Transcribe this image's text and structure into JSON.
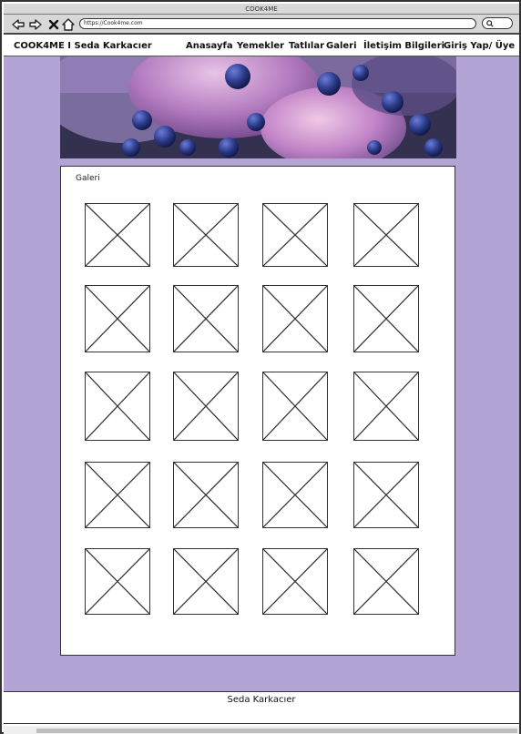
{
  "window": {
    "title": "COOK4ME"
  },
  "browser": {
    "url": "https://Cook4me.com",
    "buttons": [
      "back-icon",
      "forward-icon",
      "close-icon",
      "home-icon"
    ],
    "search_icon": "search-icon"
  },
  "nav": {
    "brand": "COOK4ME I Seda Karkacıer",
    "items": [
      {
        "label": "Anasayfa"
      },
      {
        "label": "Yemekler"
      },
      {
        "label": "Tatlılar"
      },
      {
        "label": "Galeri"
      },
      {
        "label": "İletişim Bilgileri"
      },
      {
        "label": "Giriş Yap/ Üye"
      }
    ]
  },
  "hero": {
    "image": "blueberry-ice-cream-image"
  },
  "gallery": {
    "title": "Galeri",
    "placeholder_icon": "image-placeholder-icon"
  },
  "footer": {
    "text": "Seda Karkacıer"
  },
  "colors": {
    "page_background": "#b2a4d4",
    "panel": "#ffffff",
    "chrome": "#d8d8d8",
    "border": "#333333"
  }
}
